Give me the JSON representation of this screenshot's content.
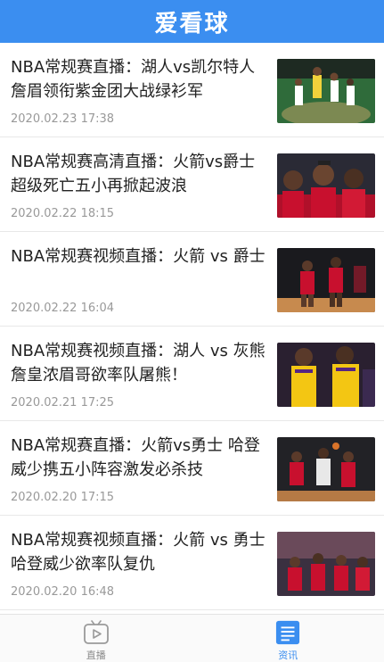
{
  "app": {
    "title": "爱看球"
  },
  "colors": {
    "brand": "#3b8ef0",
    "text": "#222222",
    "meta": "#999999"
  },
  "news": [
    {
      "title": "NBA常规赛直播：湖人vs凯尔特人 詹眉领衔紫金团大战绿衫军",
      "time": "2020.02.23 17:38",
      "thumb": "lakers-vs-celtics-photo"
    },
    {
      "title": "NBA常规赛高清直播：火箭vs爵士 超级死亡五小再掀起波浪",
      "time": "2020.02.22 18:15",
      "thumb": "rockets-players-photo"
    },
    {
      "title": "NBA常规赛视频直播：火箭 vs 爵士",
      "time": "2020.02.22 16:04",
      "thumb": "rockets-game-photo"
    },
    {
      "title": "NBA常规赛视频直播：湖人 vs 灰熊 詹皇浓眉哥欲率队屠熊！",
      "time": "2020.02.21 17:25",
      "thumb": "lakers-players-photo"
    },
    {
      "title": "NBA常规赛直播：火箭vs勇士 哈登威少携五小阵容激发必杀技",
      "time": "2020.02.20 17:15",
      "thumb": "rockets-court-photo"
    },
    {
      "title": "NBA常规赛视频直播：火箭 vs 勇士 哈登威少欲率队复仇",
      "time": "2020.02.20 16:48",
      "thumb": "rockets-bench-photo"
    }
  ],
  "tabs": [
    {
      "label": "直播",
      "icon": "tv-play-icon",
      "active": false
    },
    {
      "label": "资讯",
      "icon": "news-document-icon",
      "active": true
    }
  ]
}
